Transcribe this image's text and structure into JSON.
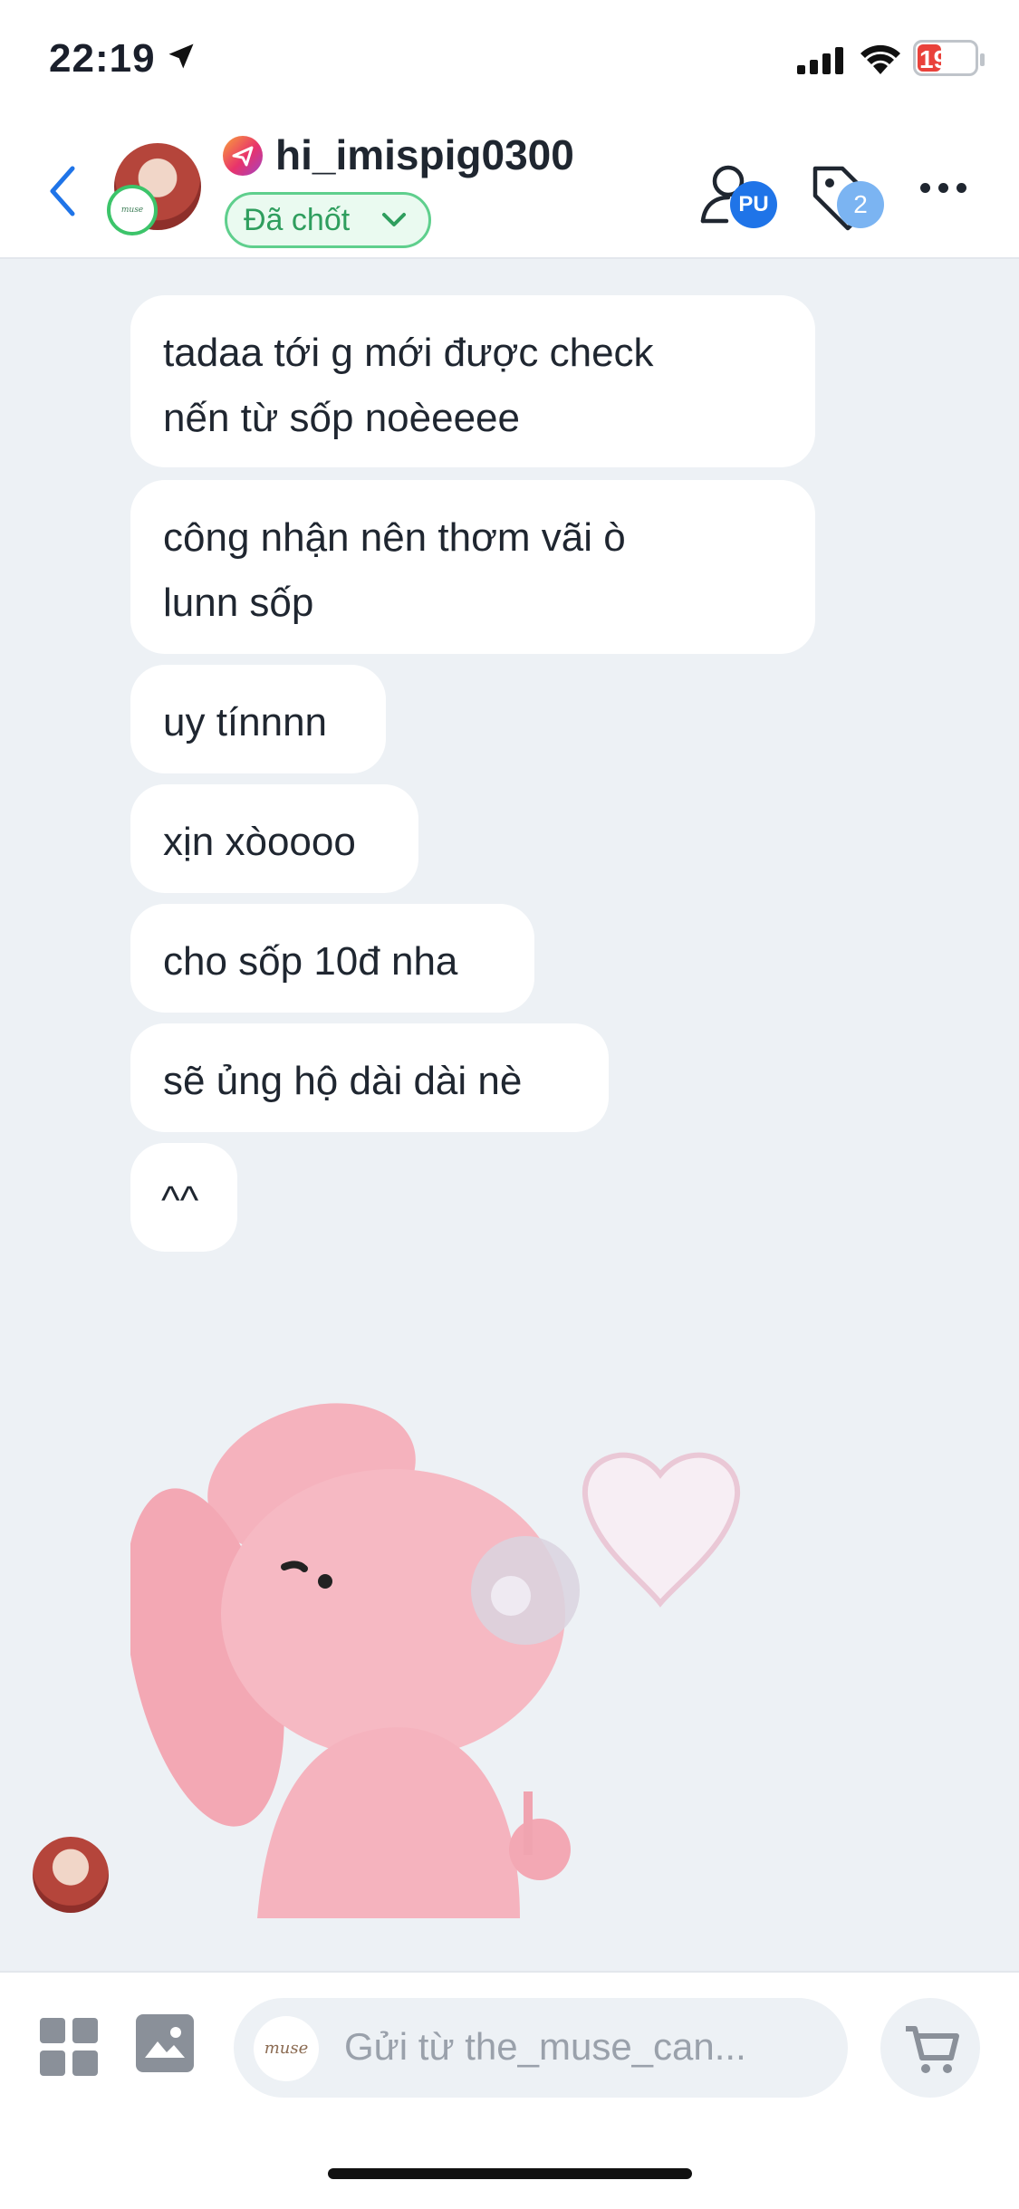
{
  "status_bar": {
    "time": "22:19",
    "battery": "19"
  },
  "header": {
    "username": "hi_imispig0300",
    "status_label": "Đã chốt",
    "assignee_initials": "PU",
    "tag_count": "2",
    "shop_badge_text": "muse"
  },
  "messages": [
    {
      "text": "tadaa tới g mới được check\nnến từ sốp noèeeee"
    },
    {
      "text": "công nhận nên thơm vãi ò\nlunn sốp"
    },
    {
      "text": "uy tínnnn"
    },
    {
      "text": "xịn xòoooo"
    },
    {
      "text": "cho sốp 10đ nha"
    },
    {
      "text": "sẽ ủng hộ dài dài nè"
    },
    {
      "text": "^^"
    }
  ],
  "composer": {
    "placeholder": "Gửi từ the_muse_can...",
    "shop_logo_text": "muse"
  },
  "colors": {
    "background": "#edf1f5",
    "accent_blue": "#1f74e8",
    "status_green": "#2f9e5e",
    "battery_low": "#e9423b"
  }
}
